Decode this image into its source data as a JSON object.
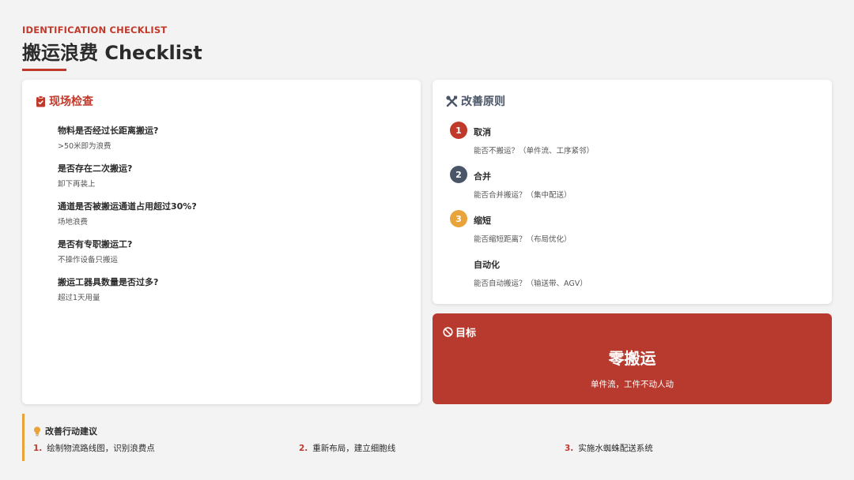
{
  "header": {
    "eyebrow": "IDENTIFICATION CHECKLIST",
    "title": "搬运浪费 Checklist"
  },
  "onsite": {
    "title": "现场检查",
    "icon": "clipboard-check-icon",
    "items": [
      {
        "q": "物料是否经过长距离搬运?",
        "d": ">50米即为浪费"
      },
      {
        "q": "是否存在二次搬运?",
        "d": "卸下再装上"
      },
      {
        "q": "通道是否被搬运通道占用超过30%?",
        "d": "场地浪费"
      },
      {
        "q": "是否有专职搬运工?",
        "d": "不操作设备只搬运"
      },
      {
        "q": "搬运工器具数量是否过多?",
        "d": "超过1天用量"
      }
    ]
  },
  "principles": {
    "title": "改善原则",
    "icon": "tools-icon",
    "items": [
      {
        "num": "1",
        "name": "取消",
        "desc": "能否不搬运？（单件流、工序紧邻）",
        "color": "#c0392b"
      },
      {
        "num": "2",
        "name": "合并",
        "desc": "能否合并搬运？（集中配送）",
        "color": "#4a5568"
      },
      {
        "num": "3",
        "name": "缩短",
        "desc": "能否缩短距离？（布局优化）",
        "color": "#e8a33a"
      },
      {
        "num": "",
        "name": "自动化",
        "desc": "能否自动搬运？（输送带、AGV）",
        "color": ""
      }
    ]
  },
  "goal": {
    "title": "目标",
    "icon": "ban-icon",
    "main": "零搬运",
    "sub": "单件流，工件不动人动"
  },
  "actions": {
    "title": "改善行动建议",
    "icon": "lightbulb-icon",
    "items": [
      {
        "num": "1.",
        "text": "绘制物流路线图，识别浪费点"
      },
      {
        "num": "2.",
        "text": "重新布局，建立细胞线"
      },
      {
        "num": "3.",
        "text": "实施水蜘蛛配送系统"
      }
    ]
  },
  "colors": {
    "accent": "#c0392b",
    "slate": "#4a5568",
    "amber": "#e8a33a",
    "goal_bg": "#b83a2e"
  }
}
